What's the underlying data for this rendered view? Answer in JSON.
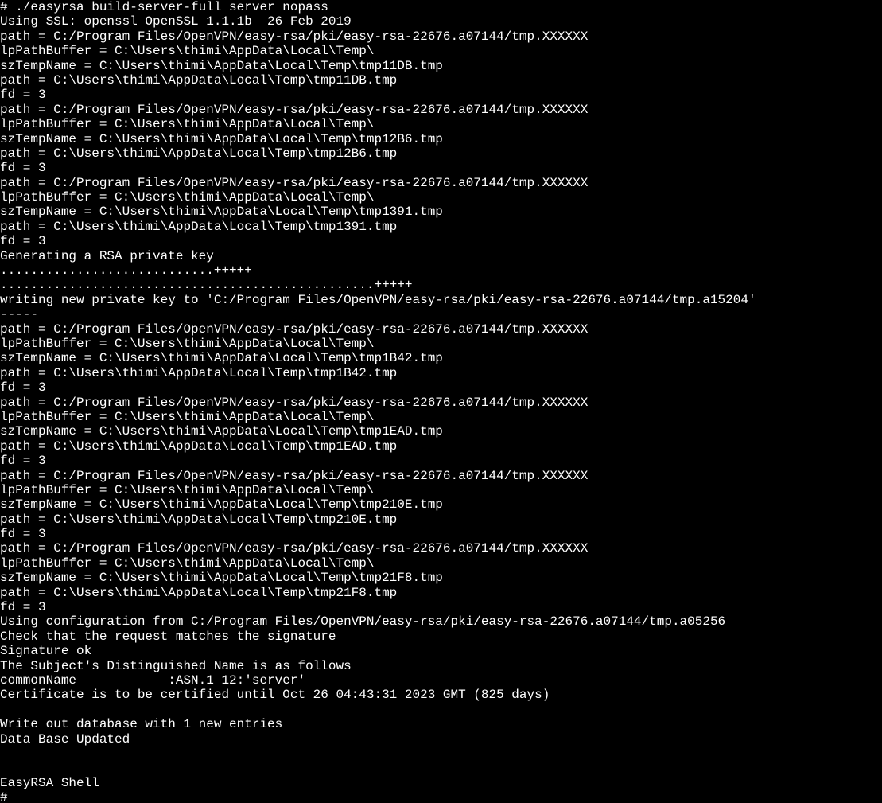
{
  "lines": [
    "# ./easyrsa build-server-full server nopass",
    "Using SSL: openssl OpenSSL 1.1.1b  26 Feb 2019",
    "path = C:/Program Files/OpenVPN/easy-rsa/pki/easy-rsa-22676.a07144/tmp.XXXXXX",
    "lpPathBuffer = C:\\Users\\thimi\\AppData\\Local\\Temp\\",
    "szTempName = C:\\Users\\thimi\\AppData\\Local\\Temp\\tmp11DB.tmp",
    "path = C:\\Users\\thimi\\AppData\\Local\\Temp\\tmp11DB.tmp",
    "fd = 3",
    "path = C:/Program Files/OpenVPN/easy-rsa/pki/easy-rsa-22676.a07144/tmp.XXXXXX",
    "lpPathBuffer = C:\\Users\\thimi\\AppData\\Local\\Temp\\",
    "szTempName = C:\\Users\\thimi\\AppData\\Local\\Temp\\tmp12B6.tmp",
    "path = C:\\Users\\thimi\\AppData\\Local\\Temp\\tmp12B6.tmp",
    "fd = 3",
    "path = C:/Program Files/OpenVPN/easy-rsa/pki/easy-rsa-22676.a07144/tmp.XXXXXX",
    "lpPathBuffer = C:\\Users\\thimi\\AppData\\Local\\Temp\\",
    "szTempName = C:\\Users\\thimi\\AppData\\Local\\Temp\\tmp1391.tmp",
    "path = C:\\Users\\thimi\\AppData\\Local\\Temp\\tmp1391.tmp",
    "fd = 3",
    "Generating a RSA private key",
    "............................+++++",
    ".................................................+++++",
    "writing new private key to 'C:/Program Files/OpenVPN/easy-rsa/pki/easy-rsa-22676.a07144/tmp.a15204'",
    "-----",
    "path = C:/Program Files/OpenVPN/easy-rsa/pki/easy-rsa-22676.a07144/tmp.XXXXXX",
    "lpPathBuffer = C:\\Users\\thimi\\AppData\\Local\\Temp\\",
    "szTempName = C:\\Users\\thimi\\AppData\\Local\\Temp\\tmp1B42.tmp",
    "path = C:\\Users\\thimi\\AppData\\Local\\Temp\\tmp1B42.tmp",
    "fd = 3",
    "path = C:/Program Files/OpenVPN/easy-rsa/pki/easy-rsa-22676.a07144/tmp.XXXXXX",
    "lpPathBuffer = C:\\Users\\thimi\\AppData\\Local\\Temp\\",
    "szTempName = C:\\Users\\thimi\\AppData\\Local\\Temp\\tmp1EAD.tmp",
    "path = C:\\Users\\thimi\\AppData\\Local\\Temp\\tmp1EAD.tmp",
    "fd = 3",
    "path = C:/Program Files/OpenVPN/easy-rsa/pki/easy-rsa-22676.a07144/tmp.XXXXXX",
    "lpPathBuffer = C:\\Users\\thimi\\AppData\\Local\\Temp\\",
    "szTempName = C:\\Users\\thimi\\AppData\\Local\\Temp\\tmp210E.tmp",
    "path = C:\\Users\\thimi\\AppData\\Local\\Temp\\tmp210E.tmp",
    "fd = 3",
    "path = C:/Program Files/OpenVPN/easy-rsa/pki/easy-rsa-22676.a07144/tmp.XXXXXX",
    "lpPathBuffer = C:\\Users\\thimi\\AppData\\Local\\Temp\\",
    "szTempName = C:\\Users\\thimi\\AppData\\Local\\Temp\\tmp21F8.tmp",
    "path = C:\\Users\\thimi\\AppData\\Local\\Temp\\tmp21F8.tmp",
    "fd = 3",
    "Using configuration from C:/Program Files/OpenVPN/easy-rsa/pki/easy-rsa-22676.a07144/tmp.a05256",
    "Check that the request matches the signature",
    "Signature ok",
    "The Subject's Distinguished Name is as follows",
    "commonName            :ASN.1 12:'server'",
    "Certificate is to be certified until Oct 26 04:43:31 2023 GMT (825 days)",
    "",
    "Write out database with 1 new entries",
    "Data Base Updated",
    "",
    "",
    "EasyRSA Shell",
    "# "
  ]
}
